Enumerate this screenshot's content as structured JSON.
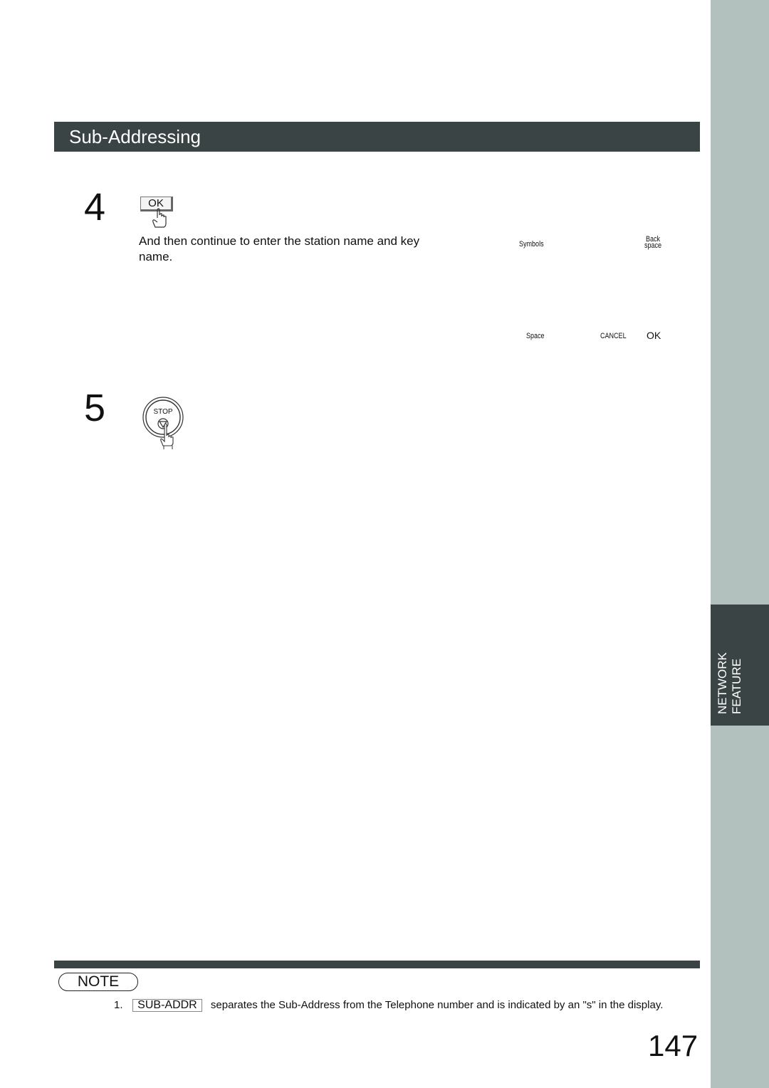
{
  "header": {
    "title": "Sub-Addressing"
  },
  "side_tab": {
    "line1": "NETWORK",
    "line2": "FEATURE"
  },
  "steps": [
    {
      "number": "4",
      "key_label": "OK",
      "text": "And then continue to enter the station name and key name."
    },
    {
      "number": "5",
      "key_label": "STOP"
    }
  ],
  "keypad_labels": {
    "symbols": "Symbols",
    "backspace_line1": "Back",
    "backspace_line2": "space",
    "space": "Space",
    "cancel": "CANCEL",
    "ok": "OK"
  },
  "note": {
    "badge": "NOTE",
    "items": [
      {
        "number": "1.",
        "key": "SUB-ADDR",
        "text": "separates the Sub-Address from the Telephone number and is indicated by an \"s\" in the display."
      }
    ]
  },
  "page_number": "147"
}
